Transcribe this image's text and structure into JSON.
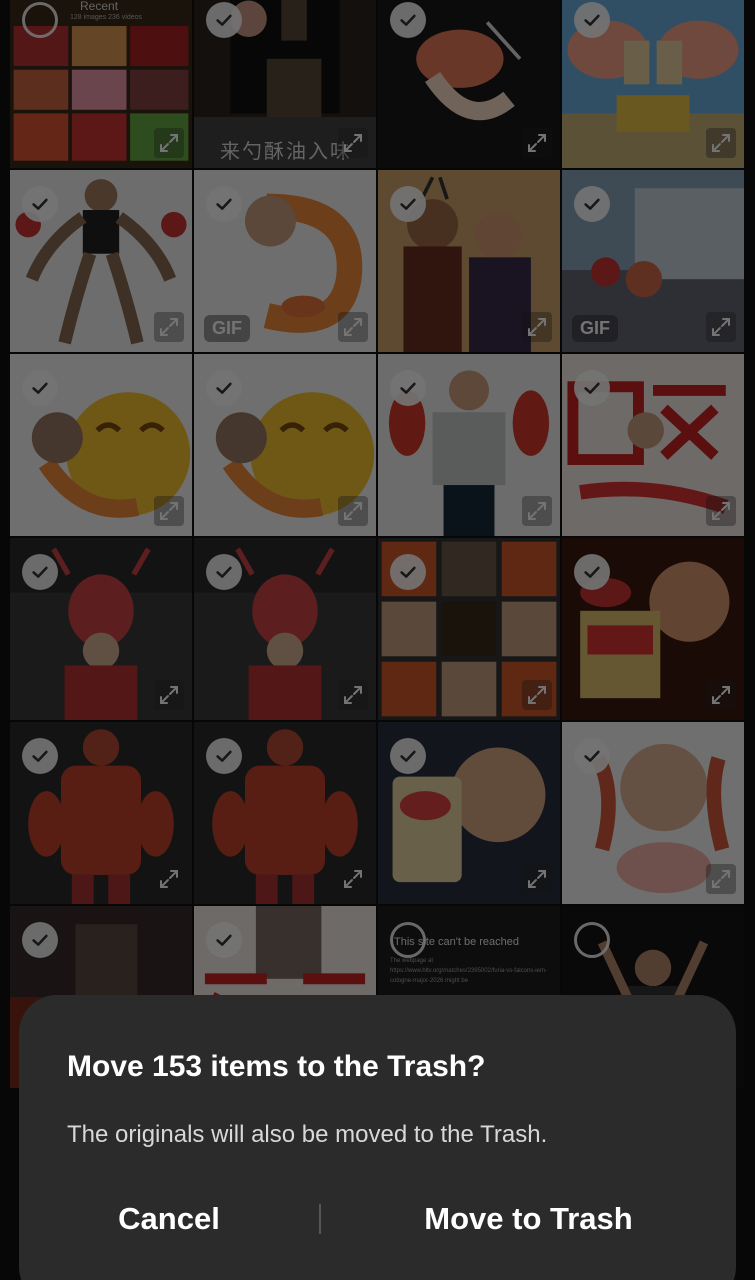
{
  "gallery": {
    "header": {
      "title": "Recent",
      "subtitle": "128 images 236 videos"
    },
    "thumbs": [
      {
        "selected": false,
        "scene": "recent-album"
      },
      {
        "selected": true,
        "scene": "cooking",
        "overlay_text": "来勺酥油入味"
      },
      {
        "selected": true,
        "scene": "dark-shrimp"
      },
      {
        "selected": true,
        "scene": "sponge-buff"
      },
      {
        "selected": true,
        "scene": "lobster-arms"
      },
      {
        "selected": true,
        "scene": "shrimp-face",
        "badge": "GIF"
      },
      {
        "selected": true,
        "scene": "painting"
      },
      {
        "selected": true,
        "scene": "ship-lobster",
        "badge": "GIF"
      },
      {
        "selected": true,
        "scene": "emoji-shrimp"
      },
      {
        "selected": true,
        "scene": "emoji-shrimp"
      },
      {
        "selected": true,
        "scene": "jersey-claws"
      },
      {
        "selected": true,
        "scene": "calligraphy"
      },
      {
        "selected": true,
        "scene": "lobster-costume-dark"
      },
      {
        "selected": true,
        "scene": "lobster-costume-dark"
      },
      {
        "selected": true,
        "scene": "collage"
      },
      {
        "selected": true,
        "scene": "chips-laugh"
      },
      {
        "selected": true,
        "scene": "red-suit"
      },
      {
        "selected": true,
        "scene": "red-suit"
      },
      {
        "selected": true,
        "scene": "chips-closeup"
      },
      {
        "selected": true,
        "scene": "crying-sticker"
      },
      {
        "selected": true,
        "scene": "partial-red"
      },
      {
        "selected": true,
        "scene": "partial-calligraphy"
      },
      {
        "selected": false,
        "scene": "error-page",
        "error_title": "This site can't be reached",
        "error_body": "The webpage at https://www.hltv.org/matches/2395002/furia-vs-falcons-iem-cologne-major-2026 might be"
      },
      {
        "selected": false,
        "scene": "dark-stage"
      }
    ]
  },
  "dialog": {
    "title": "Move 153 items to the Trash?",
    "body": "The originals will also be moved to the Trash.",
    "cancel_label": "Cancel",
    "confirm_label": "Move to Trash"
  },
  "icons": {
    "check": "checkmark-icon",
    "expand": "expand-icon"
  },
  "colors": {
    "dialog_bg": "#2b2b2b",
    "text_primary": "#ffffff",
    "text_secondary": "#d8d8d8"
  }
}
